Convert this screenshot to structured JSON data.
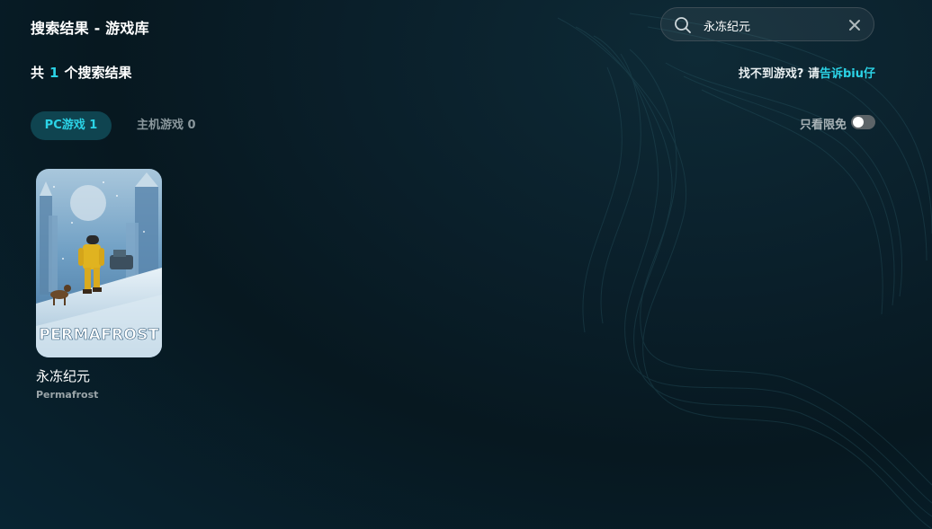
{
  "header": {
    "title": "搜索结果 - 游戏库"
  },
  "search": {
    "value": "永冻纪元",
    "placeholder": ""
  },
  "summary": {
    "prefix": "共",
    "count": "1",
    "suffix": "个搜索结果"
  },
  "feedback": {
    "text": "找不到游戏? 请",
    "link": "告诉biu仔"
  },
  "tabs": [
    {
      "label": "PC游戏 1",
      "active": true
    },
    {
      "label": "主机游戏 0",
      "active": false
    }
  ],
  "filter": {
    "label": "只看限免",
    "enabled": false
  },
  "results": [
    {
      "title": "永冻纪元",
      "subtitle": "Permafrost",
      "cover_text": "PERMAFROST"
    }
  ],
  "colors": {
    "accent": "#2bd3e6",
    "background": "#071820",
    "active_tab_bg": "#0f4450",
    "muted_text": "#8a979c"
  },
  "icons": {
    "search": "search-icon",
    "clear": "close-icon"
  }
}
